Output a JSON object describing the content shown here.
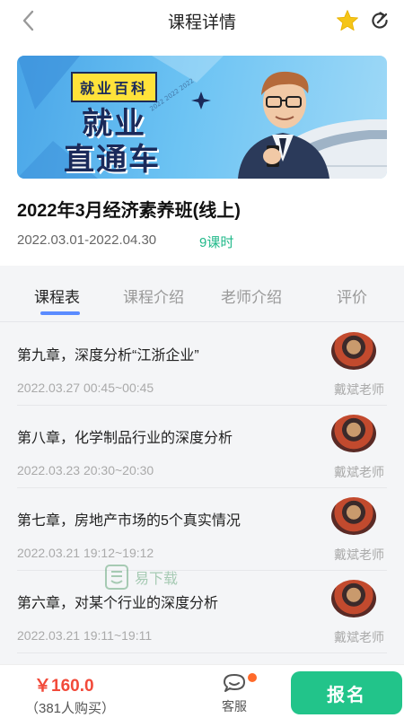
{
  "header": {
    "title": "课程详情",
    "icons": {
      "back": "chevron-left-icon",
      "favorite": "star-icon",
      "share": "share-icon"
    },
    "accent": "#f5c518"
  },
  "banner": {
    "tag": "就业百科",
    "line1": "就业",
    "line2": "直通车",
    "colors": {
      "background": "#4aa6e8",
      "text": "#1a2a5a",
      "tag": "#ffe23a"
    }
  },
  "course": {
    "title": "2022年3月经济素养班(线上)",
    "date_range": "2022.03.01-2022.04.30",
    "hours": "9课时",
    "hours_color": "#21b98a"
  },
  "tabs": [
    {
      "label": "课程表",
      "active": true
    },
    {
      "label": "课程介绍",
      "active": false
    },
    {
      "label": "老师介绍",
      "active": false
    },
    {
      "label": "评价",
      "active": false
    }
  ],
  "lessons": [
    {
      "name": "第九章，深度分析“江浙企业”",
      "time": "2022.03.27   00:45~00:45",
      "teacher": "戴斌老师"
    },
    {
      "name": "第八章，化学制品行业的深度分析",
      "time": "2022.03.23   20:30~20:30",
      "teacher": "戴斌老师"
    },
    {
      "name": "第七章，房地产市场的5个真实情况",
      "time": "2022.03.21   19:12~19:12",
      "teacher": "戴斌老师"
    },
    {
      "name": "第六章，对某个行业的深度分析",
      "time": "2022.03.21   19:11~19:11",
      "teacher": "戴斌老师"
    }
  ],
  "watermark": {
    "text": "易下载"
  },
  "bottom": {
    "price": "￥160.0",
    "buyers": "（381人购买）",
    "service_label": "客服",
    "enroll_label": "报名",
    "enroll_color": "#22c48a",
    "price_color": "#f24a3a"
  }
}
